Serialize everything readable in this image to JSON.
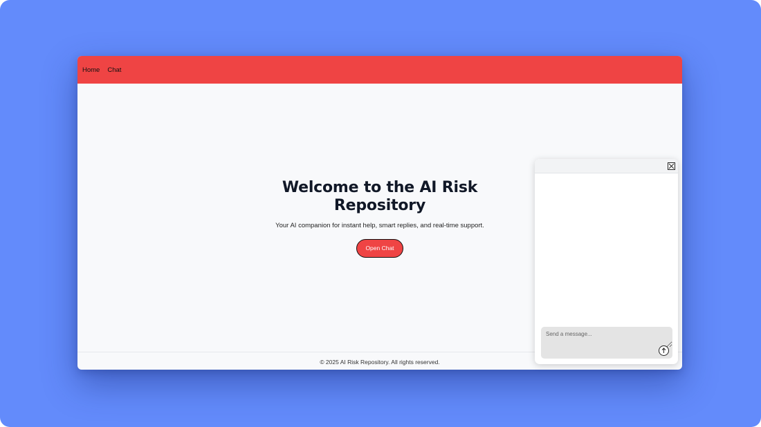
{
  "nav": {
    "links": [
      {
        "label": "Home"
      },
      {
        "label": "Chat"
      }
    ]
  },
  "hero": {
    "title": "Welcome to the AI Risk Repository",
    "subtitle": "Your AI companion for instant help, smart replies, and real-time support.",
    "cta_label": "Open Chat"
  },
  "footer": {
    "text": "© 2025 AI Risk Repository. All rights reserved."
  },
  "chat": {
    "input_placeholder": "Send a message...",
    "close_icon": "close-icon",
    "send_icon": "arrow-up-icon"
  },
  "colors": {
    "backdrop": "#638bfb",
    "accent": "#ef4444",
    "page_bg": "#f8f9fb",
    "title": "#111827"
  }
}
